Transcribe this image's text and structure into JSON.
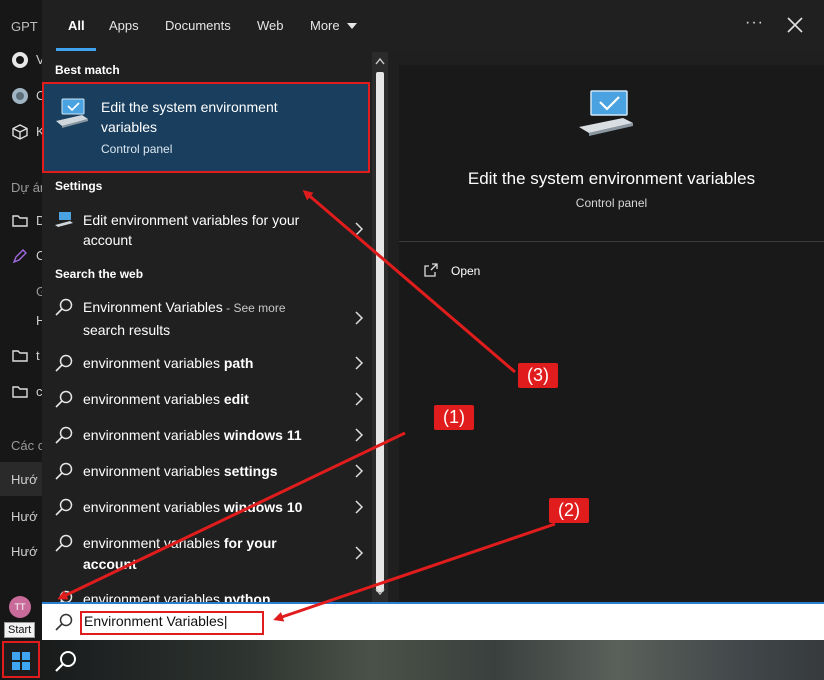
{
  "background_app": {
    "header": "GPT",
    "items": [
      "V",
      "C",
      "K"
    ],
    "section_projects": "Dự án",
    "project_items": [
      "D",
      "C",
      "G",
      "H"
    ],
    "folders": [
      "t",
      "c"
    ],
    "section_chats": "Các c",
    "chat_items": [
      "Hướ",
      "Hướ",
      "Hướ"
    ],
    "avatar_initials": "TT"
  },
  "tabs": [
    {
      "label": "All",
      "selected": true
    },
    {
      "label": "Apps"
    },
    {
      "label": "Documents"
    },
    {
      "label": "Web"
    },
    {
      "label": "More"
    }
  ],
  "window_controls": {
    "more_glyph": "···",
    "close_glyph": "×"
  },
  "results": {
    "best_match_heading": "Best match",
    "best_match": {
      "title": "Edit the system environment variables",
      "subtitle": "Control panel"
    },
    "settings_heading": "Settings",
    "settings_item": "Edit environment variables for your account",
    "web_heading": "Search the web",
    "web_first": {
      "main": "Environment Variables",
      "more": " - See more",
      "line2": "search results"
    },
    "web_suggestions": [
      {
        "prefix": "environment variables ",
        "bold": "path"
      },
      {
        "prefix": "environment variables ",
        "bold": "edit"
      },
      {
        "prefix": "environment variables ",
        "bold": "windows 11"
      },
      {
        "prefix": "environment variables ",
        "bold": "settings"
      },
      {
        "prefix": "environment variables ",
        "bold": "windows 10"
      },
      {
        "prefix": "environment variables ",
        "bold": "for your",
        "bold2": "account"
      },
      {
        "prefix": "environment variables ",
        "bold": "python"
      }
    ]
  },
  "preview": {
    "title": "Edit the system environment variables",
    "subtitle": "Control panel",
    "action_open": "Open"
  },
  "search": {
    "value": "Environment Variables",
    "caret": "|"
  },
  "taskbar": {
    "start_tooltip": "Start"
  },
  "annotations": {
    "label1": "(1)",
    "label2": "(2)",
    "label3": "(3)"
  },
  "colors": {
    "accent": "#3fa5f0",
    "annotation_red": "#e11c1c",
    "selected_bg": "#1a3f5e"
  },
  "icons": [
    "monitor-icon",
    "settings-monitor-icon",
    "search-icon",
    "chevron-right-icon",
    "open-icon",
    "close-icon",
    "windows-logo-icon"
  ]
}
